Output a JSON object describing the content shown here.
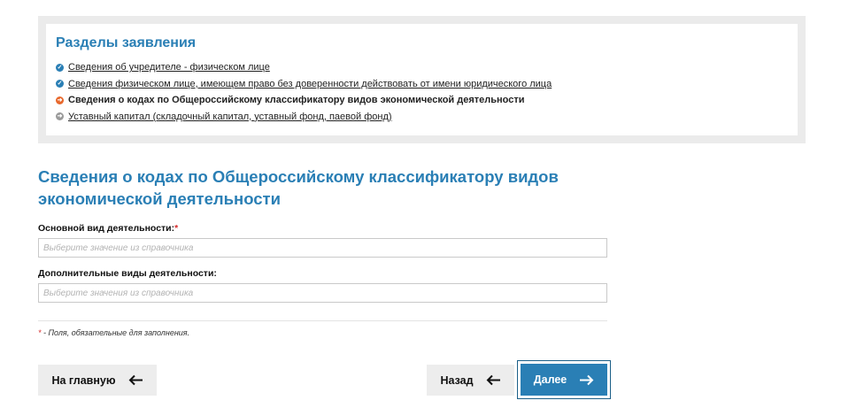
{
  "sections": {
    "title": "Разделы заявления",
    "items": [
      {
        "label": "Сведения об учредителе - физическом лице",
        "state": "done"
      },
      {
        "label": "Сведения физическом лице, имеющем право без доверенности действовать от имени юридического лица",
        "state": "done"
      },
      {
        "label": "Сведения о кодах по Общероссийскому классификатору видов экономической деятельности",
        "state": "current"
      },
      {
        "label": "Уставный капитал (складочный капитал, уставный фонд, паевой фонд)",
        "state": "pending"
      }
    ],
    "icons": {
      "done": "check-circle-icon",
      "current": "arrow-right-circle-icon",
      "pending": "arrow-right-circle-icon"
    }
  },
  "form": {
    "title": "Сведения о кодах по Общероссийскому классификатору видов экономической деятельности",
    "main_activity": {
      "label": "Основной вид деятельности:",
      "required_mark": "*",
      "value": "",
      "placeholder": "Выберите значение из справочника"
    },
    "additional_activities": {
      "label": "Дополнительные виды деятельности:",
      "value": "",
      "placeholder": "Выберите значения из справочника"
    },
    "required_note": {
      "mark": "*",
      "text": " - Поля, обязательные для заполнения."
    }
  },
  "buttons": {
    "home": {
      "label": "На главную",
      "icon": "arrow-left-icon"
    },
    "back": {
      "label": "Назад",
      "icon": "arrow-left-icon"
    },
    "next": {
      "label": "Далее",
      "icon": "arrow-right-icon"
    }
  },
  "colors": {
    "accent": "#2a7fb5",
    "current_section": "#e8682c",
    "pending_section": "#9a9a9a",
    "required": "#d62b2b",
    "panel_bg": "#ebebeb"
  }
}
